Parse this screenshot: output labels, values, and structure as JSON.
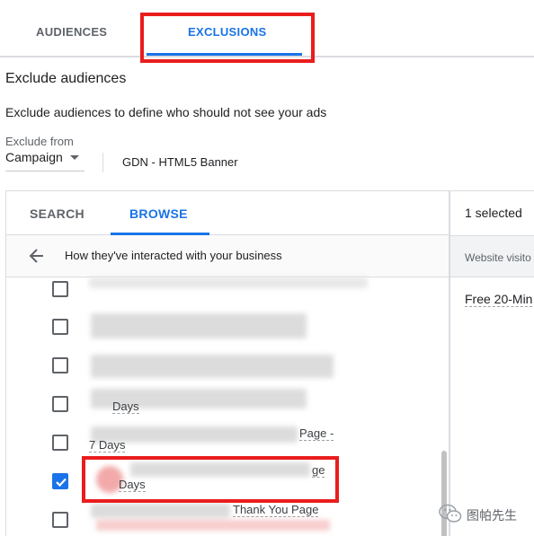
{
  "top_tabs": {
    "audiences": "AUDIENCES",
    "exclusions": "EXCLUSIONS",
    "active": "exclusions"
  },
  "section": {
    "title": "Exclude audiences",
    "description": "Exclude audiences to define who should not see your ads"
  },
  "exclude_from": {
    "label": "Exclude from",
    "value": "Campaign",
    "campaign_name": "GDN - HTML5 Banner"
  },
  "browser": {
    "tabs": {
      "search": "SEARCH",
      "browse": "BROWSE",
      "active": "browse"
    },
    "breadcrumb": "How they've interacted with your business",
    "items": [
      {
        "text": "",
        "checked": false
      },
      {
        "text": "",
        "checked": false
      },
      {
        "text": "",
        "checked": false
      },
      {
        "text": "Days",
        "checked": false
      },
      {
        "text": "Page -",
        "text2": "7 Days",
        "checked": false
      },
      {
        "text": "ge",
        "text2": "Days",
        "checked": true
      },
      {
        "text": "Thank You Page",
        "checked": false
      }
    ]
  },
  "selection": {
    "count": "1 selected",
    "header": "Website visito",
    "items": [
      "Free 20-Min"
    ]
  },
  "watermark": {
    "text": "图帕先生",
    "icon": "wechat-icon"
  },
  "colors": {
    "accent": "#1a73e8",
    "highlight": "#ea1d1d"
  }
}
